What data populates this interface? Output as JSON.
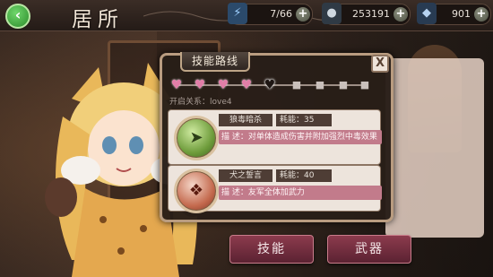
{
  "page": {
    "title": "居所"
  },
  "resources": [
    {
      "icon": "lightning-icon",
      "value": "7/66"
    },
    {
      "icon": "coin-icon",
      "value": "253191"
    },
    {
      "icon": "gem-icon",
      "value": "901"
    }
  ],
  "dialog": {
    "title": "技能路线",
    "close_label": "X",
    "relation_label": "开启关系：love4",
    "hearts": [
      "filled",
      "filled",
      "filled",
      "filled",
      "current",
      "locked",
      "locked",
      "locked",
      "locked"
    ],
    "skills": [
      {
        "icon": "arrow-skill-icon",
        "name": "狼毒暗杀",
        "cost": "耗能：35",
        "desc": "描 述：对单体造成伤害并附加强烈中毒效果"
      },
      {
        "icon": "claw-skill-icon",
        "name": "犬之誓言",
        "cost": "耗能：40",
        "desc": "描 述：友军全体加武力"
      }
    ]
  },
  "bottom_buttons": {
    "skill": "技能",
    "weapon": "武器"
  }
}
